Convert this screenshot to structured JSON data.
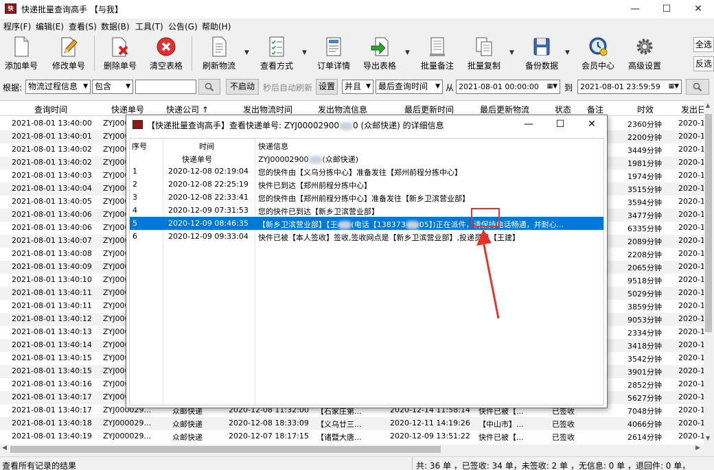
{
  "app": {
    "title": "快递批量查询高手 【与我】",
    "icon": "app-logo-icon",
    "window_controls": {
      "minimize": "—",
      "maximize": "☐",
      "close": "✕"
    }
  },
  "menu": [
    "程序(F)",
    "编辑(E)",
    "查看(S)",
    "数据(B)",
    "工具(T)",
    "公告(G)",
    "帮助(H)"
  ],
  "toolbar": [
    {
      "label": "添加单号",
      "icon": "document-icon"
    },
    {
      "label": "修改单号",
      "icon": "pencil-icon"
    },
    {
      "label": "删除单号",
      "icon": "delete-x-icon"
    },
    {
      "label": "清空表格",
      "icon": "clear-circle-icon"
    },
    {
      "label": "刷新物流",
      "icon": "refresh-doc-icon"
    },
    {
      "label": "查看方式",
      "icon": "checklist-icon"
    },
    {
      "label": "订单详情",
      "icon": "detail-icon"
    },
    {
      "label": "导出表格",
      "icon": "export-icon"
    },
    {
      "label": "批量备注",
      "icon": "note-icon"
    },
    {
      "label": "批量复制",
      "icon": "copy-icon"
    },
    {
      "label": "备份数据",
      "icon": "floppy-icon"
    },
    {
      "label": "会员中心",
      "icon": "clock-icon"
    },
    {
      "label": "高级设置",
      "icon": "gear-icon"
    }
  ],
  "side_buttons": {
    "select_all": "全选",
    "invert": "反选"
  },
  "filter": {
    "label": "根据:",
    "field": "物流过程信息",
    "op": "包含",
    "keyword": "",
    "auto_btn": "不启动",
    "auto_text": "秒后自动刷新",
    "set_btn": "设置",
    "logic": "并且",
    "time_field": "最后查询时间",
    "from_label": "从",
    "from": "2021-08-01 00:00:00",
    "to_label": "到",
    "to": "2021-08-01 23:59:59"
  },
  "grid": {
    "headers": [
      "查询时间",
      "快递单号",
      "快递公司 ↑",
      "发出物流时间",
      "发出物流信息",
      "最后更新时间",
      "最后更新物流",
      "状态",
      "备注",
      "时效",
      "发出日"
    ],
    "rows": [
      {
        "t": "2021-08-01 13:40:00",
        "no": "ZYJ000029...",
        "eff": "2360分钟",
        "d": "2020-1"
      },
      {
        "t": "2021-08-01 13:40:01",
        "no": "ZYJ000029...",
        "eff": "2200分钟",
        "d": "2020-1"
      },
      {
        "t": "2021-08-01 13:40:02",
        "no": "ZYJ000029...",
        "eff": "3449分钟",
        "d": "2020-1"
      },
      {
        "t": "2021-08-01 13:40:02",
        "no": "ZYJ000029...",
        "eff": "1981分钟",
        "d": "2020-1"
      },
      {
        "t": "2021-08-01 13:40:03",
        "no": "ZYJ000029...",
        "eff": "1974分钟",
        "d": "2020-1"
      },
      {
        "t": "2021-08-01 13:40:04",
        "no": "ZYJ000029...",
        "eff": "3515分钟",
        "d": "2020-1"
      },
      {
        "t": "2021-08-01 13:40:05",
        "no": "ZYJ000029...",
        "eff": "3594分钟",
        "d": "2020-1"
      },
      {
        "t": "2021-08-01 13:40:06",
        "no": "ZYJ000029...",
        "eff": "3477分钟",
        "d": "2020-1"
      },
      {
        "t": "2021-08-01 13:40:06",
        "no": "ZYJ000029...",
        "eff": "6335分钟",
        "d": "2020-1"
      },
      {
        "t": "2021-08-01 13:40:07",
        "no": "ZYJ000029...",
        "eff": "2089分钟",
        "d": "2020-1"
      },
      {
        "t": "2021-08-01 13:40:08",
        "no": "ZYJ000029...",
        "eff": "2208分钟",
        "d": "2020-1"
      },
      {
        "t": "2021-08-01 13:40:09",
        "no": "ZYJ000029...",
        "eff": "2065分钟",
        "d": "2020-1"
      },
      {
        "t": "2021-08-01 13:40:10",
        "no": "ZYJ000029...",
        "eff": "9518分钟",
        "d": "2020-1"
      },
      {
        "t": "2021-08-01 13:40:11",
        "no": "ZYJ000029...",
        "eff": "5029分钟",
        "d": "2020-1"
      },
      {
        "t": "2021-08-01 13:40:11",
        "no": "ZYJ000029...",
        "eff": "3859分钟",
        "d": "2020-1"
      },
      {
        "t": "2021-08-01 13:40:12",
        "no": "ZYJ000029...",
        "eff": "9053分钟",
        "d": "2020-1"
      },
      {
        "t": "2021-08-01 13:40:13",
        "no": "ZYJ000029...",
        "eff": "2334分钟",
        "d": "2020-1"
      },
      {
        "t": "2021-08-01 13:40:14",
        "no": "ZYJ000029...",
        "eff": "3418分钟",
        "d": "2020-1"
      },
      {
        "t": "2021-08-01 13:40:15",
        "no": "ZYJ000029...",
        "eff": "3542分钟",
        "d": "2020-1"
      },
      {
        "t": "2021-08-01 13:40:15",
        "no": "ZYJ000029...",
        "eff": "3901分钟",
        "d": "2020-1"
      },
      {
        "t": "2021-08-01 13:40:16",
        "no": "ZYJ000029...",
        "eff": "2852分钟",
        "d": "2020-1"
      },
      {
        "t": "2021-08-01 13:40:17",
        "no": "ZYJ000029...",
        "eff": "5627分钟",
        "d": "2020-1"
      },
      {
        "t": "2021-08-01 13:40:17",
        "no": "ZYJ000029...",
        "co": "众邮快递",
        "st": "2020-12-08 11:32:00",
        "si": "【石家庄第...",
        "lt": "2020-12-14 11:58:14",
        "li": "快件已被【...",
        "s": "已签收",
        "eff": "7048分钟",
        "d": "2020-1"
      },
      {
        "t": "2021-08-01 13:40:18",
        "no": "ZYJ000029...",
        "co": "众邮快递",
        "st": "2020-12-08 18:33:09",
        "si": "【义乌廿三...",
        "lt": "2020-12-11 14:19:26",
        "li": "【中山市】...",
        "s": "已签收",
        "eff": "4066分钟",
        "d": "2020-1"
      },
      {
        "t": "2021-08-01 13:40:19",
        "no": "ZYJ000029...",
        "co": "众邮快递",
        "st": "2020-12-07 18:17:15",
        "si": "【诸暨大唐...",
        "lt": "2020-12-09 13:51:22",
        "li": "快件已被【...",
        "s": "已签收",
        "eff": "2614分钟",
        "d": "2020-1"
      }
    ]
  },
  "dialog": {
    "title": "【快递批量查询高手】查看快递单号: ZYJ00002900",
    "title_suffix": "0 (众邮快递) 的详细信息",
    "col_no": "序号",
    "col_time": "时间",
    "col_info": "快递信息",
    "sub_time": "快递单号",
    "sub_info": "ZYJ00002900",
    "sub_info_suffix": "(众邮快递)",
    "rows": [
      {
        "n": "1",
        "t": "2020-12-08 02:19:04",
        "i": "您的快件由【义乌分拣中心】准备发往【郑州前程分拣中心】"
      },
      {
        "n": "2",
        "t": "2020-12-08 22:25:19",
        "i": "快件已到达【郑州前程分拣中心】"
      },
      {
        "n": "3",
        "t": "2020-12-08 22:33:41",
        "i": "您的快件由【郑州前程分拣中心】准备发往【新乡卫滨营业部】"
      },
      {
        "n": "4",
        "t": "2020-12-09 07:31:53",
        "i": "您的快件已到达【新乡卫滨营业部】"
      },
      {
        "n": "5",
        "t": "2020-12-09 08:46:35",
        "i": "【新乡卫滨营业部】【王",
        "i2": "(电话【138373",
        "i3": "05】)正在派件，请保持电话畅通，并耐心..."
      },
      {
        "n": "6",
        "t": "2020-12-09 09:33:04",
        "i": "快件已被【本人签收】签收,签收网点是【新乡卫滨营业部】,投递员是【王建】"
      }
    ]
  },
  "status": {
    "left": "查看所有记录的结果",
    "right": "共: 36 单 ，已签收:  34 单，未签收:  2 单 ，无信息: 0 单 ，退回件: 0 单，"
  },
  "colors": {
    "selection": "#0078d7",
    "annotation": "#e5332a",
    "app_icon": "#8b1a1a"
  }
}
